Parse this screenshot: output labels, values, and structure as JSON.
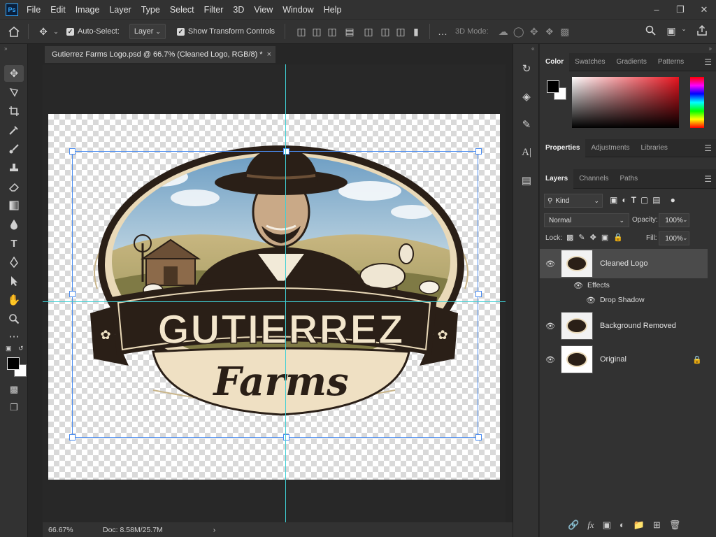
{
  "app": {
    "logo_text": "Ps"
  },
  "menu": [
    "File",
    "Edit",
    "Image",
    "Layer",
    "Type",
    "Select",
    "Filter",
    "3D",
    "View",
    "Window",
    "Help"
  ],
  "options": {
    "auto_select_label": "Auto-Select:",
    "auto_select_value": "Layer",
    "transform_label": "Show Transform Controls",
    "mode_3d_label": "3D Mode:"
  },
  "document": {
    "tab_title": "Gutierrez Farms Logo.psd @ 66.7% (Cleaned Logo, RGB/8) *",
    "close_glyph": "×",
    "zoom": "66.67%",
    "doc_info": "Doc: 8.58M/25.7M"
  },
  "logo": {
    "line1": "GUTIERREZ",
    "line2": "Farms"
  },
  "panels": {
    "color_tabs": [
      "Color",
      "Swatches",
      "Gradients",
      "Patterns"
    ],
    "props_tabs": [
      "Properties",
      "Adjustments",
      "Libraries"
    ],
    "layers_tabs": [
      "Layers",
      "Channels",
      "Paths"
    ],
    "filter_kind": "Kind",
    "blend_mode": "Normal",
    "opacity_label": "Opacity:",
    "opacity_value": "100%",
    "lock_label": "Lock:",
    "fill_label": "Fill:",
    "fill_value": "100%"
  },
  "layers": [
    {
      "name": "Cleaned Logo",
      "selected": true
    },
    {
      "name": "Background Removed",
      "selected": false
    },
    {
      "name": "Original",
      "selected": false,
      "locked": true
    }
  ],
  "effects": {
    "label": "Effects",
    "item": "Drop Shadow"
  },
  "colors": {
    "accent": "#31a8ff",
    "guide": "#3fd0d6",
    "bbox": "#4a8cf0",
    "logo_dark": "#2a1f17",
    "logo_cream": "#f3e6cc"
  }
}
